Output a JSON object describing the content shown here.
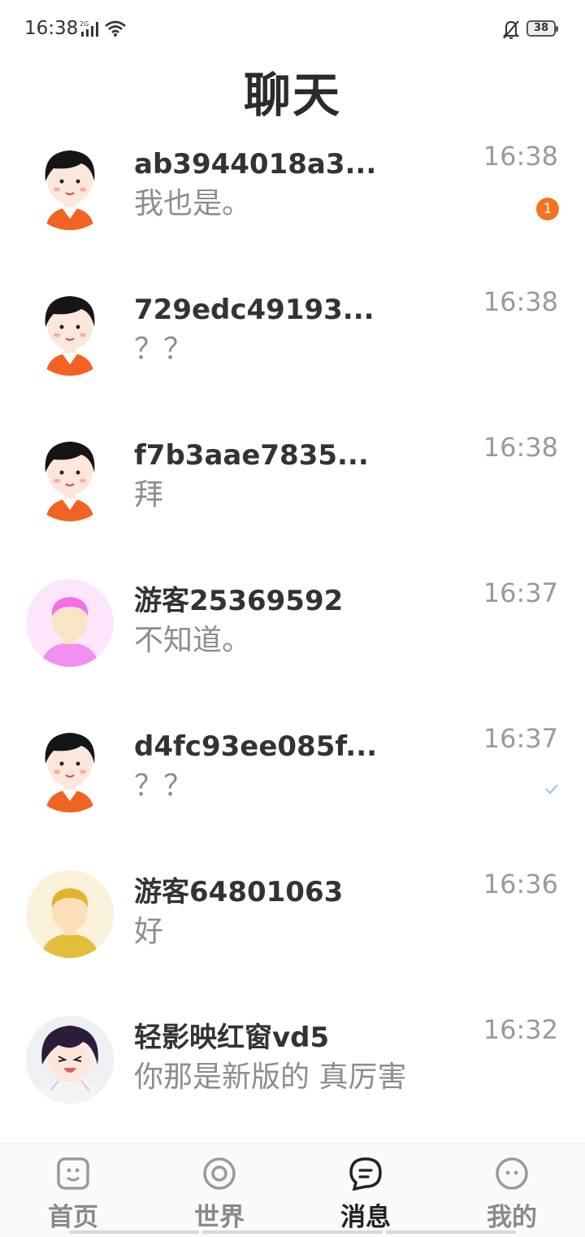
{
  "status_bar": {
    "time": "16:38",
    "network": "2G",
    "battery": "38",
    "icons": [
      "signal-icon",
      "wifi-icon",
      "mute-bell-icon",
      "battery-icon"
    ]
  },
  "header": {
    "title": "聊天"
  },
  "chats": [
    {
      "name": "ab3944018a3...",
      "message": "我也是。",
      "time": "16:38",
      "badge": "1",
      "avatar": "cartoon-girl-avatar"
    },
    {
      "name": "729edc49193...",
      "message": "？？",
      "time": "16:38",
      "avatar": "cartoon-girl-avatar"
    },
    {
      "name": "f7b3aae7835...",
      "message": "拜",
      "time": "16:38",
      "avatar": "cartoon-girl-avatar"
    },
    {
      "name": "游客25369592",
      "message": "不知道。",
      "time": "16:37",
      "avatar": "pink-guest-avatar"
    },
    {
      "name": "d4fc93ee085f...",
      "message": "？？",
      "time": "16:37",
      "status": "read-check-icon",
      "avatar": "cartoon-girl-avatar"
    },
    {
      "name": "游客64801063",
      "message": "好",
      "time": "16:36",
      "avatar": "yellow-guest-avatar"
    },
    {
      "name": "轻影映红窗vd5",
      "message": "你那是新版的 真厉害",
      "time": "16:32",
      "avatar": "anime-avatar"
    }
  ],
  "bottom_nav": [
    {
      "label": "首页",
      "icon": "home-face-icon",
      "active": false
    },
    {
      "label": "世界",
      "icon": "world-circle-icon",
      "active": false
    },
    {
      "label": "消息",
      "icon": "message-bubble-icon",
      "active": true
    },
    {
      "label": "我的",
      "icon": "profile-face-icon",
      "active": false
    }
  ],
  "colors": {
    "badge": "#f5731e",
    "accent_text": "#222222",
    "muted_text": "#8d8d8d"
  }
}
